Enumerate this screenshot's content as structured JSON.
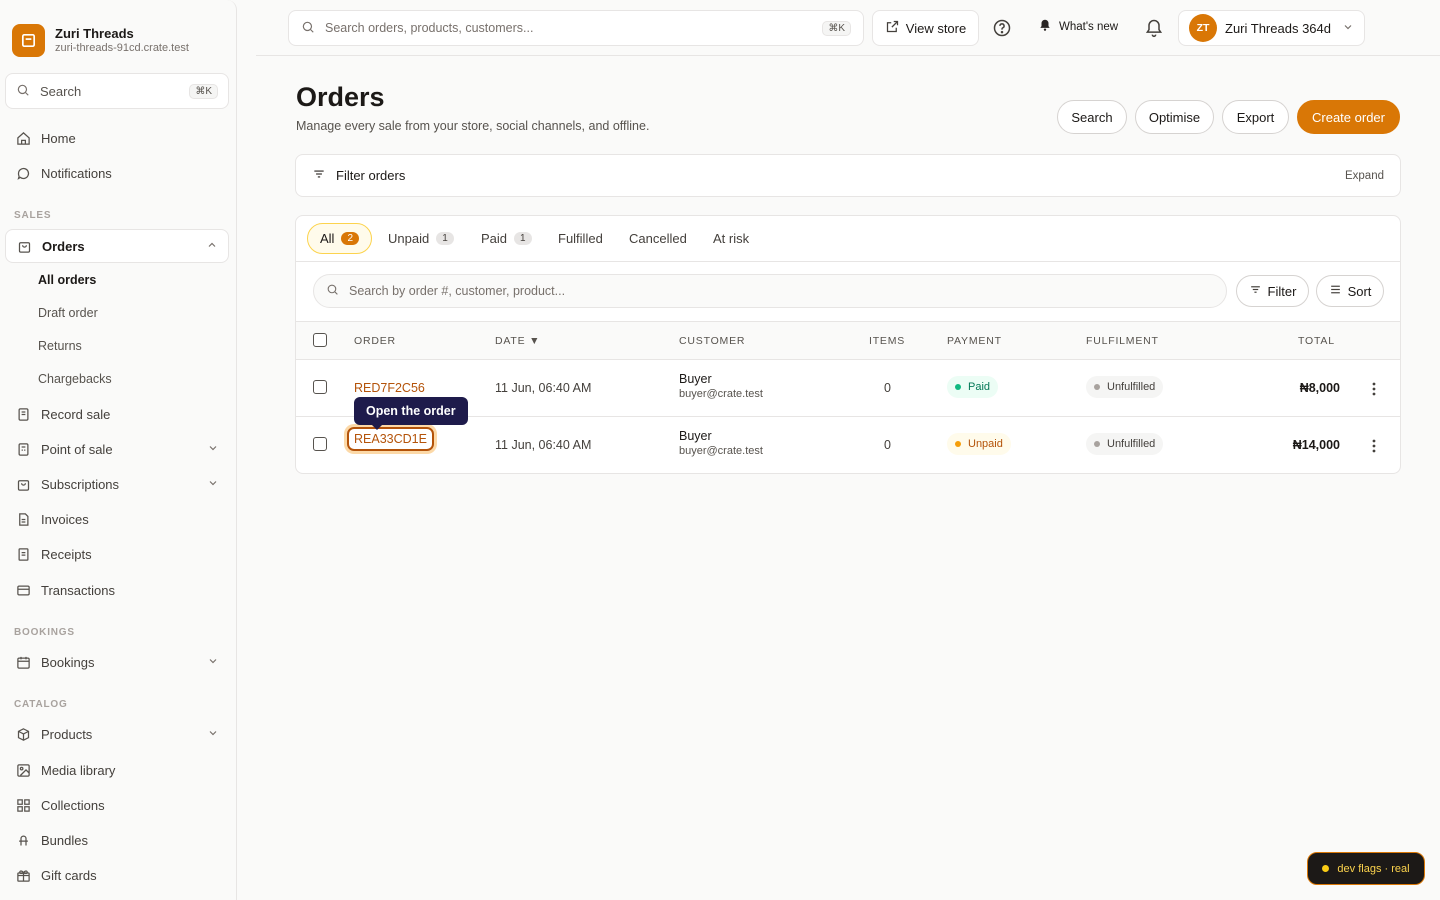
{
  "brand": {
    "name": "Zuri Threads",
    "domain": "zuri-threads-91cd.crate.test"
  },
  "sidebar": {
    "search_label": "Search",
    "search_shortcut": "⌘K",
    "home": "Home",
    "notifications": "Notifications",
    "section_sales": "SALES",
    "orders": "Orders",
    "orders_sub": [
      "All orders",
      "Draft order",
      "Returns",
      "Chargebacks"
    ],
    "record_sale": "Record sale",
    "point_of_sale": "Point of sale",
    "subscriptions": "Subscriptions",
    "invoices": "Invoices",
    "receipts": "Receipts",
    "transactions": "Transactions",
    "section_bookings": "BOOKINGS",
    "bookings": "Bookings",
    "section_catalog": "CATALOG",
    "products": "Products",
    "media_library": "Media library",
    "collections": "Collections",
    "bundles": "Bundles",
    "gift_cards": "Gift cards"
  },
  "topbar": {
    "search_placeholder": "Search orders, products, customers...",
    "search_shortcut": "⌘K",
    "view_store": "View store",
    "whats_new": "What's new",
    "avatar_initials": "ZT",
    "account_name": "Zuri Threads 364d"
  },
  "page": {
    "title": "Orders",
    "subtitle": "Manage every sale from your store, social channels, and offline.",
    "buttons": {
      "search": "Search",
      "optimise": "Optimise",
      "export": "Export",
      "create": "Create order"
    },
    "filter_label": "Filter orders",
    "expand_label": "Expand"
  },
  "tabs": [
    {
      "label": "All",
      "count": "2"
    },
    {
      "label": "Unpaid",
      "count": "1"
    },
    {
      "label": "Paid",
      "count": "1"
    },
    {
      "label": "Fulfilled"
    },
    {
      "label": "Cancelled"
    },
    {
      "label": "At risk"
    }
  ],
  "table": {
    "search_placeholder": "Search by order #, customer, product...",
    "filter": "Filter",
    "sort": "Sort",
    "headers": {
      "order": "ORDER",
      "date": "DATE ▼",
      "customer": "CUSTOMER",
      "items": "ITEMS",
      "payment": "PAYMENT",
      "fulfilment": "FULFILMENT",
      "total": "TOTAL"
    },
    "rows": [
      {
        "order": "RED7F2C56",
        "date": "11 Jun, 06:40 AM",
        "customer": "Buyer",
        "email": "buyer@crate.test",
        "items": "0",
        "payment": "Paid",
        "fulfilment": "Unfulfilled",
        "total": "₦8,000"
      },
      {
        "order": "REA33CD1E",
        "date": "11 Jun, 06:40 AM",
        "customer": "Buyer",
        "email": "buyer@crate.test",
        "items": "0",
        "payment": "Unpaid",
        "fulfilment": "Unfulfilled",
        "total": "₦14,000"
      }
    ]
  },
  "tooltip": "Open the order",
  "dev_flags": "dev flags · real",
  "colors": {
    "accent": "#d97706",
    "link": "#b45309",
    "tooltip_bg": "#1e1b4b"
  }
}
